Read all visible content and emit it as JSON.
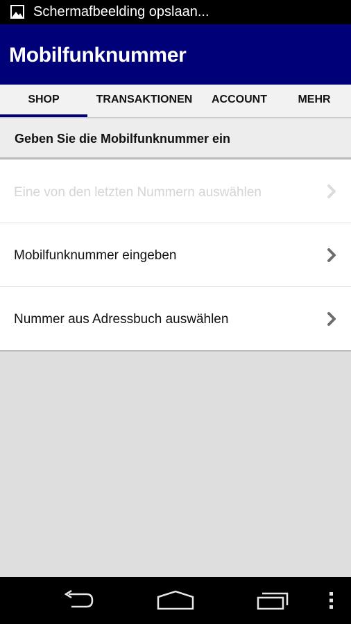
{
  "status_bar": {
    "notification_icon": "image-icon",
    "text": "Schermafbeelding opslaan..."
  },
  "action_bar": {
    "title": "Mobilfunknummer"
  },
  "tabs": [
    {
      "label": "SHOP",
      "selected": true
    },
    {
      "label": "TRANSAKTIONEN",
      "selected": false
    },
    {
      "label": "ACCOUNT",
      "selected": false
    },
    {
      "label": "MEHR",
      "selected": false
    }
  ],
  "section": {
    "header": "Geben Sie die Mobilfunknummer ein"
  },
  "list": {
    "items": [
      {
        "label": "Eine von den letzten Nummern auswählen",
        "enabled": false,
        "icon": "chevron-right-icon"
      },
      {
        "label": "Mobilfunknummer eingeben",
        "enabled": true,
        "icon": "chevron-right-icon"
      },
      {
        "label": "Nummer aus Adressbuch auswählen",
        "enabled": true,
        "icon": "chevron-right-icon"
      }
    ]
  },
  "nav_bar": {
    "buttons": [
      "back-icon",
      "home-icon",
      "recents-icon",
      "overflow-menu-icon"
    ]
  },
  "colors": {
    "action_bar": "#000078",
    "tab_indicator": "#000078",
    "background": "#dedede"
  }
}
